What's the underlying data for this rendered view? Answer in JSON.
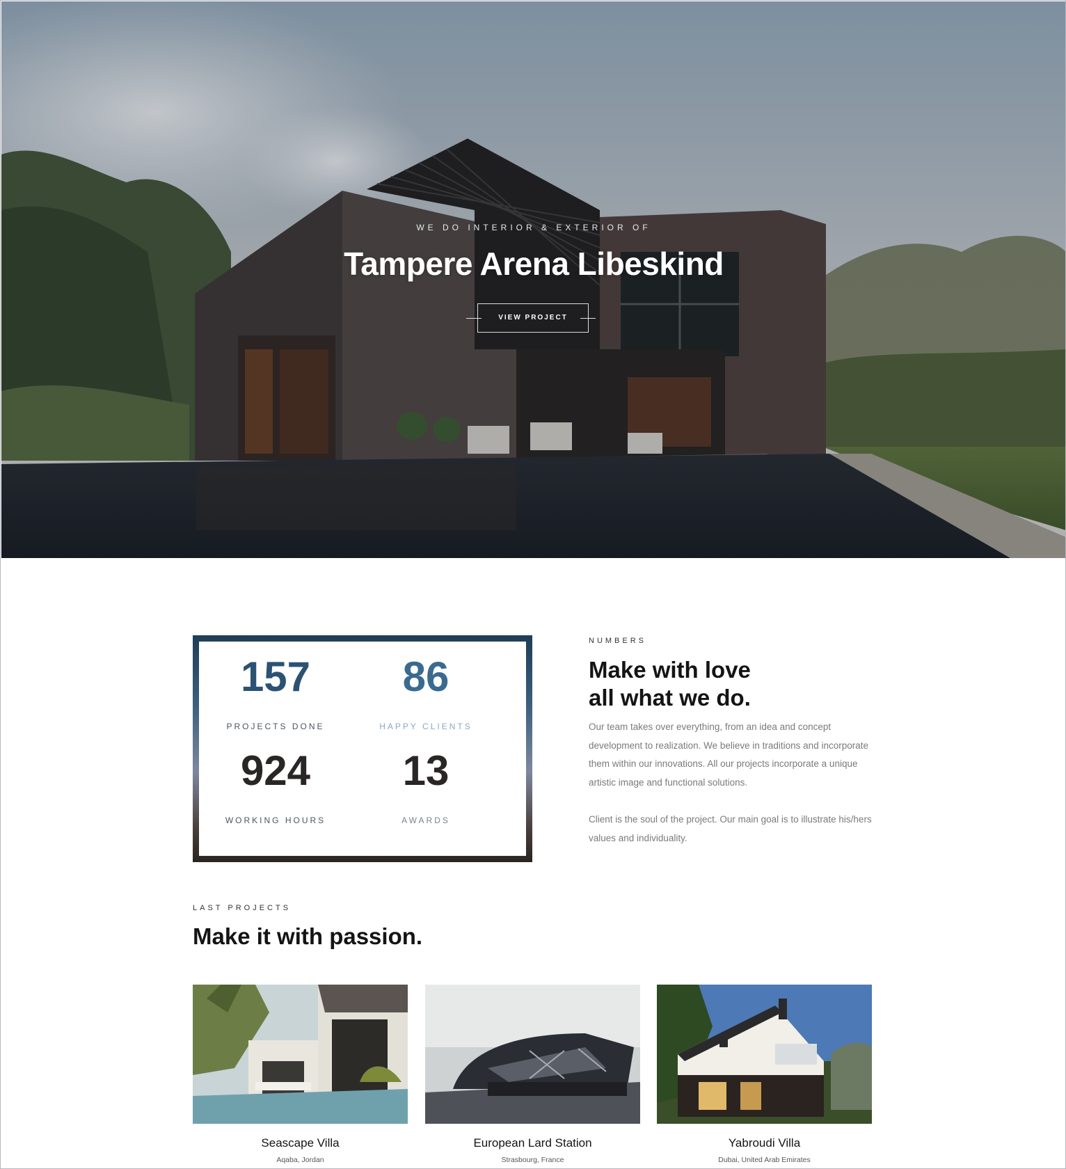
{
  "hero": {
    "kicker": "WE DO INTERIOR & EXTERIOR OF",
    "title": "Tampere Arena Libeskind",
    "button_label": "VIEW PROJECT"
  },
  "numbers": {
    "stats": [
      {
        "value": "157",
        "label": "PROJECTS DONE"
      },
      {
        "value": "86",
        "label": "HAPPY CLIENTS"
      },
      {
        "value": "924",
        "label": "WORKING HOURS"
      },
      {
        "value": "13",
        "label": "AWARDS"
      }
    ],
    "kicker": "NUMBERS",
    "title_line1": "Make with love",
    "title_line2": "all what we do.",
    "paragraph1": "Our team takes over everything, from an idea and concept development to realization. We believe in traditions and incorporate them within our innovations. All our projects incorporate a unique artistic image and functional solutions.",
    "paragraph2": "Client is the soul of the project. Our main goal is to illustrate his/hers values and individuality."
  },
  "projects": {
    "kicker": "LAST PROJECTS",
    "title": "Make it with passion.",
    "items": [
      {
        "name": "Seascape Villa",
        "location": "Aqaba, Jordan"
      },
      {
        "name": "European Lard Station",
        "location": "Strasbourg, France"
      },
      {
        "name": "Yabroudi Villa",
        "location": "Dubai, United Arab Emirates"
      }
    ]
  },
  "colors": {
    "stat_blue": "#2c5273",
    "text_dark": "#141414",
    "text_muted": "#7a7a7a"
  }
}
